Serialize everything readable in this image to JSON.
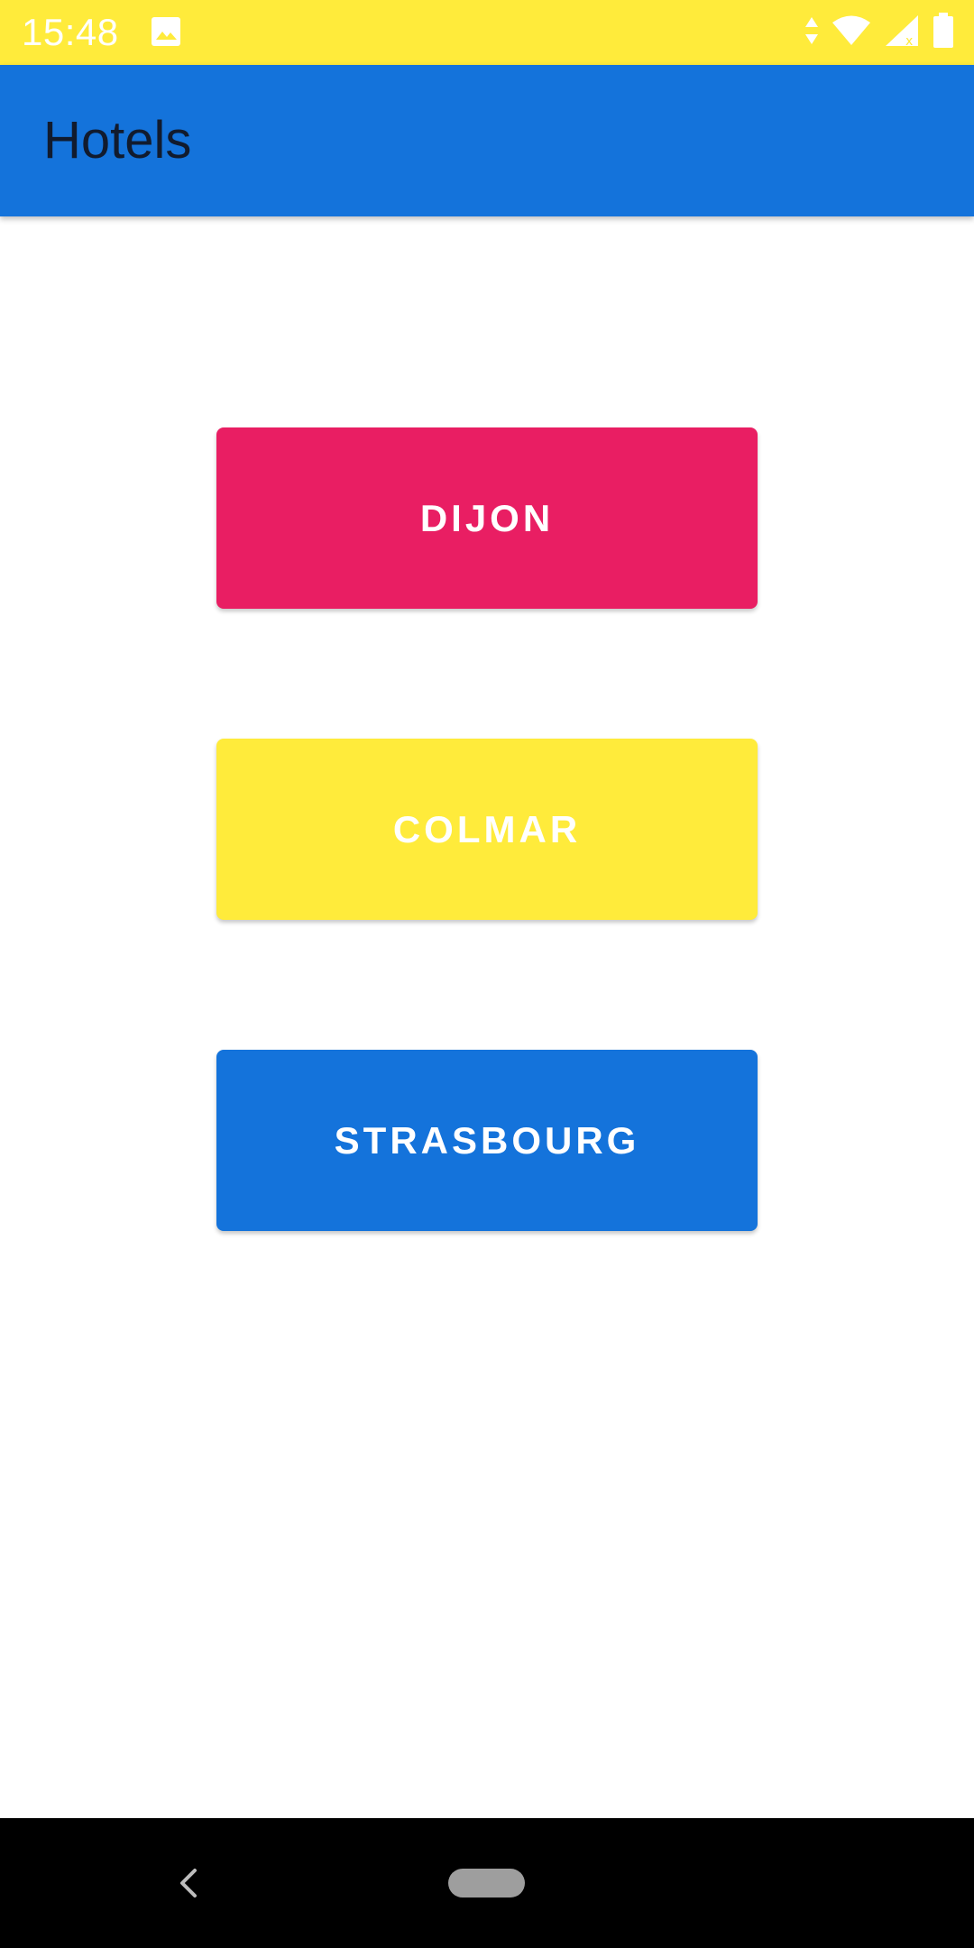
{
  "status_bar": {
    "time": "15:48",
    "background_color": "#FFEB3B",
    "icons": [
      "image-icon",
      "data-arrows-icon",
      "wifi-icon",
      "cell-signal-icon",
      "battery-icon"
    ]
  },
  "app_bar": {
    "title": "Hotels",
    "background_color": "#1473DB"
  },
  "buttons": [
    {
      "label": "DIJON",
      "color": "#E91E63"
    },
    {
      "label": "COLMAR",
      "color": "#FFEB3B"
    },
    {
      "label": "STRASBOURG",
      "color": "#1473DB"
    }
  ],
  "nav_bar": {
    "icons": [
      "back-icon",
      "home-pill-icon"
    ]
  }
}
